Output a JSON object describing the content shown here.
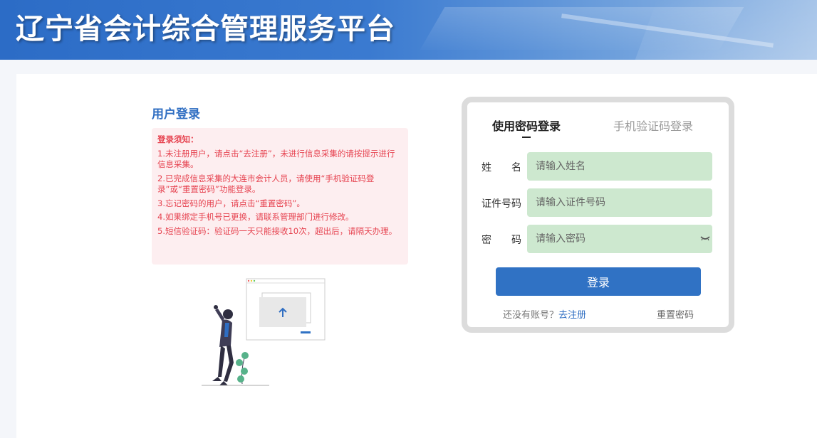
{
  "header": {
    "title": "辽宁省会计综合管理服务平台"
  },
  "left": {
    "heading": "用户登录",
    "notice": {
      "title": "登录须知：",
      "items": [
        "1.未注册用户，请点击“去注册”，未进行信息采集的请按提示进行信息采集。",
        "2.已完成信息采集的大连市会计人员，请使用“手机验证码登录”或“重置密码”功能登录。",
        "3.忘记密码的用户，请点击“重置密码”。",
        "4.如果绑定手机号已更换，请联系管理部门进行修改。",
        "5.短信验证码：验证码一天只能接收10次，超出后，请隔天办理。"
      ]
    }
  },
  "login": {
    "tabs": {
      "password": "使用密码登录",
      "sms": "手机验证码登录"
    },
    "fields": {
      "name": {
        "label": "姓　　名",
        "placeholder": "请输入姓名"
      },
      "id": {
        "label": "证件号码",
        "placeholder": "请输入证件号码"
      },
      "password": {
        "label": "密　　码",
        "placeholder": "请输入密码"
      }
    },
    "button": "登录",
    "no_account": "还没有账号？",
    "register": "去注册",
    "reset": "重置密码"
  },
  "colors": {
    "accent": "#3072c4",
    "input_bg": "#cde8cf",
    "notice_bg": "#fdeef0",
    "notice_text": "#e6424f"
  }
}
